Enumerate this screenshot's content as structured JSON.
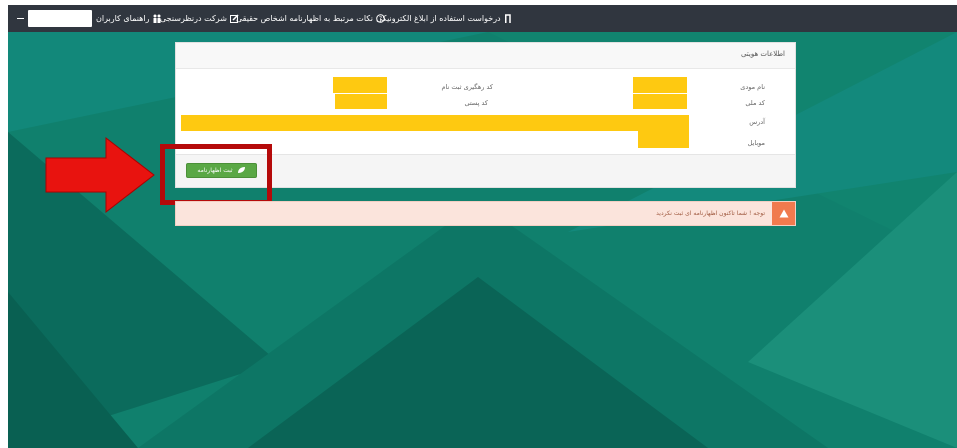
{
  "nav": {
    "guide": "راهنمای کاربران",
    "survey": "شرکت درنظرسنجی",
    "notes": "نکات مرتبط به اظهارنامه اشخاص حقیقی",
    "request": "درخواست استفاده از ابلاغ الکترونیکی"
  },
  "panel": {
    "title": "اطلاعات هویتی",
    "fields": {
      "taxpayer_name": "نام مودی",
      "tracking_code": "کد رهگیری ثبت نام",
      "national_code": "کد ملی",
      "postal_code": "کد پستی",
      "address": "آدرس",
      "mobile": "موبایل"
    },
    "submit_label": "ثبت اظهارنامه"
  },
  "alert": {
    "text": "توجه ! شما تاکنون اظهارنامه ای ثبت نکردید"
  },
  "colors": {
    "topbar": "#30363f",
    "background": "#10806d",
    "redaction": "#fec911",
    "submit": "#5aa845",
    "highlight": "#b50a0a",
    "arrow": "#e8130f",
    "alert_bg": "#fbe4dc",
    "alert_icon": "#f07a4e"
  }
}
